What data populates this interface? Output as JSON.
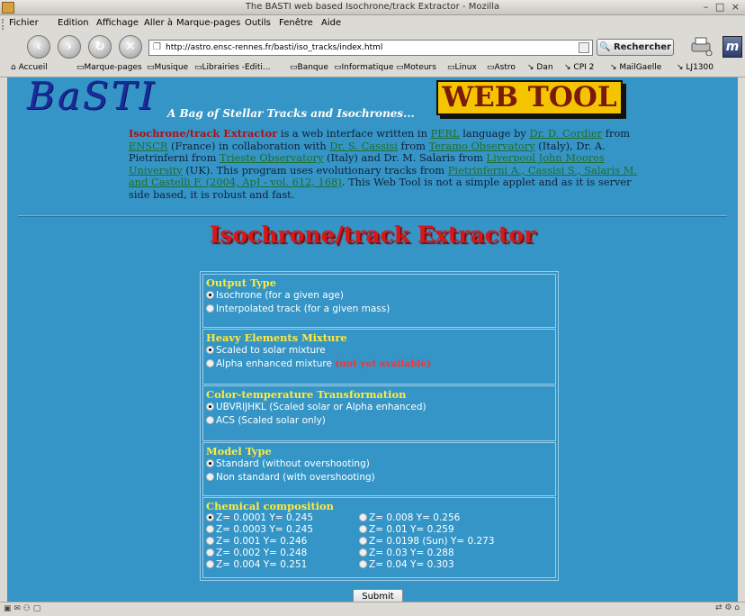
{
  "window": {
    "title": "The BASTI web based Isochrone/track Extractor - Mozilla",
    "controls": "– □ ×"
  },
  "menu": [
    "Fichier",
    "Edition",
    "Affichage",
    "Aller à",
    "Marque-pages",
    "Outils",
    "Fenêtre",
    "Aide"
  ],
  "nav": {
    "url": "http://astro.ensc-rennes.fr/basti/iso_tracks/index.html",
    "search_label": "Rechercher",
    "back": "‹",
    "forward": "›",
    "reload": "↻",
    "stop": "✕"
  },
  "bookmarks": [
    "Accueil",
    "Marque-pages",
    "Musique",
    "Librairies -Editi...",
    "Banque",
    "Informatique",
    "Moteurs",
    "Linux",
    "Astro",
    "Dan",
    "CPI 2",
    "MailGaelle",
    "LJ1300"
  ],
  "header": {
    "logo": "BaSTI",
    "tagline": "A Bag of Stellar Tracks and Isochrones...",
    "webtool": "WEB TOOL"
  },
  "intro": {
    "t1": "Isochrone/track Extractor",
    "t2": "  is a web interface written in ",
    "l1": "PERL",
    "t3": " language by ",
    "l2": "Dr. D. Cordier",
    "t4": " from ",
    "l3": "ENSCR",
    "t5": " (France) in collaboration with ",
    "l4": "Dr. S. Cassisi",
    "t6": " from ",
    "l5": "Teramo Observatory",
    "t7": " (Italy), Dr. A. Pietrinferni from ",
    "l6": "Trieste Observatory",
    "t8": " (Italy) and Dr. M. Salaris from ",
    "l7": "Liverpool John Moores University",
    "t9": " (UK). This program uses evolutionary tracks from ",
    "l8": "Pietrinferni A., Cassisi S., Salaris M. and Castelli F. (2004, ApJ - vol. 612, 168)",
    "t10": ". This Web Tool is not a simple applet and as it is server side based, it is robust and fast."
  },
  "main_title": "Isochrone/track Extractor",
  "form": {
    "output_type": {
      "heading": "Output Type",
      "options": [
        "Isochrone (for a given age)",
        "Interpolated track (for a given mass)"
      ]
    },
    "heavy": {
      "heading": "Heavy Elements Mixture",
      "options": [
        "Scaled to solar mixture",
        "Alpha enhanced mixture"
      ],
      "note": "(not yet available)"
    },
    "color": {
      "heading": "Color-temperature Transformation",
      "options": [
        "UBVRIJHKL (Scaled solar or Alpha enhanced)",
        "ACS (Scaled solar only)"
      ]
    },
    "model": {
      "heading": "Model Type",
      "options": [
        "Standard (without overshooting)",
        "Non standard (with overshooting)"
      ]
    },
    "chem": {
      "heading": "Chemical composition",
      "left": [
        "Z= 0.0001 Y= 0.245",
        "Z= 0.0003 Y= 0.245",
        "Z= 0.001 Y= 0.246",
        "Z= 0.002 Y= 0.248",
        "Z= 0.004 Y= 0.251"
      ],
      "right": [
        "Z= 0.008 Y= 0.256",
        "Z= 0.01 Y= 0.259",
        "Z= 0.0198 (Sun) Y= 0.273",
        "Z= 0.03 Y= 0.288",
        "Z= 0.04 Y= 0.303"
      ]
    },
    "submit": "Submit"
  }
}
